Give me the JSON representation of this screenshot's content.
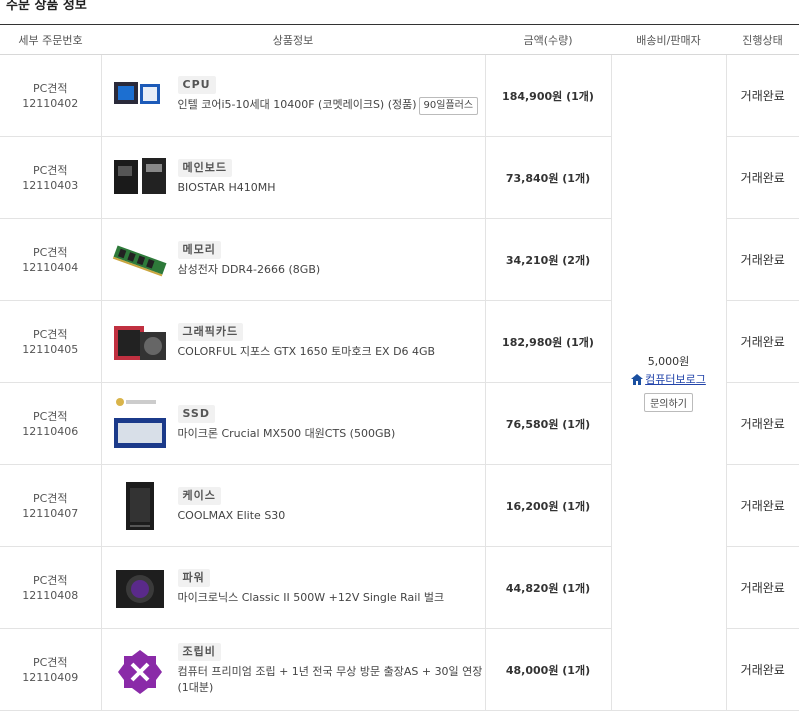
{
  "section_title": "주문 상품 정보",
  "headers": {
    "order_no": "세부 주문번호",
    "product": "상품정보",
    "amount": "금액(수량)",
    "shipping_seller": "배송비/판매자",
    "status": "진행상태"
  },
  "shipping": {
    "fee": "5,000원",
    "seller": "컴퓨터보로그",
    "ask_button": "문의하기"
  },
  "items": [
    {
      "order_type": "PC견적",
      "order_no": "12110402",
      "category": "CPU",
      "name": "인텔 코어i5-10세대 10400F (코멧레이크S) (정품)",
      "badge": "90일플러스",
      "price": "184,900원 (1개)",
      "status": "거래완료",
      "icon": "cpu-icon"
    },
    {
      "order_type": "PC견적",
      "order_no": "12110403",
      "category": "메인보드",
      "name": "BIOSTAR H410MH",
      "price": "73,840원 (1개)",
      "status": "거래완료",
      "icon": "motherboard-icon"
    },
    {
      "order_type": "PC견적",
      "order_no": "12110404",
      "category": "메모리",
      "name": "삼성전자 DDR4-2666 (8GB)",
      "price": "34,210원 (2개)",
      "status": "거래완료",
      "icon": "ram-icon"
    },
    {
      "order_type": "PC견적",
      "order_no": "12110405",
      "category": "그래픽카드",
      "name": "COLORFUL 지포스 GTX 1650 토마호크 EX D6 4GB",
      "price": "182,980원 (1개)",
      "status": "거래완료",
      "icon": "gpu-icon"
    },
    {
      "order_type": "PC견적",
      "order_no": "12110406",
      "category": "SSD",
      "name": "마이크론 Crucial MX500 대원CTS (500GB)",
      "price": "76,580원 (1개)",
      "status": "거래완료",
      "icon": "ssd-icon"
    },
    {
      "order_type": "PC견적",
      "order_no": "12110407",
      "category": "케이스",
      "name": "COOLMAX Elite S30",
      "price": "16,200원 (1개)",
      "status": "거래완료",
      "icon": "case-icon"
    },
    {
      "order_type": "PC견적",
      "order_no": "12110408",
      "category": "파워",
      "name": "마이크로닉스 Classic II 500W +12V Single Rail 벌크",
      "price": "44,820원 (1개)",
      "status": "거래완료",
      "icon": "psu-icon"
    },
    {
      "order_type": "PC견적",
      "order_no": "12110409",
      "category": "조립비",
      "name": "컴퓨터 프리미엄 조립 + 1년 전국 무상 방문 출장AS + 30일 연장 (1대분)",
      "price": "48,000원 (1개)",
      "status": "거래완료",
      "icon": "assembly-icon"
    }
  ]
}
